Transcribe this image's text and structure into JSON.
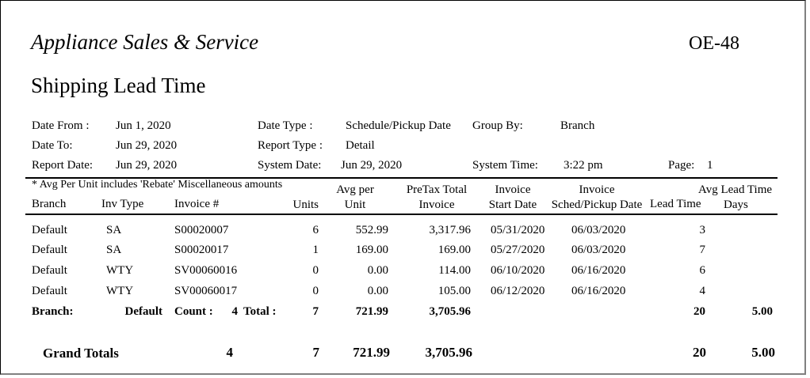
{
  "report": {
    "company": "Appliance Sales & Service",
    "code": "OE-48",
    "title": "Shipping Lead Time"
  },
  "params": {
    "date_from_label": "Date From :",
    "date_from": "Jun 1, 2020",
    "date_to_label": "Date To:",
    "date_to": "Jun 29, 2020",
    "report_date_label": "Report Date:",
    "report_date": "Jun 29, 2020",
    "date_type_label": "Date Type :",
    "date_type": "Schedule/Pickup Date",
    "report_type_label": "Report Type :",
    "report_type": "Detail",
    "system_date_label": "System Date:",
    "system_date": "Jun 29, 2020",
    "group_by_label": "Group  By:",
    "group_by": "Branch",
    "system_time_label": "System Time:",
    "system_time": "3:22 pm",
    "page_label": "Page:",
    "page": "1"
  },
  "columns": {
    "note": "* Avg Per Unit includes 'Rebate' Miscellaneous amounts",
    "branch": "Branch",
    "inv_type": "Inv Type",
    "invoice_no": "Invoice #",
    "units": "Units",
    "avg_per_1": "Avg per",
    "avg_per_2": "Unit",
    "pretax_1": "PreTax Total",
    "pretax_2": "Invoice",
    "start_1": "Invoice",
    "start_2": "Start Date",
    "sched_1": "Invoice",
    "sched_2": "Sched/Pickup Date",
    "lead_time": "Lead Time",
    "avg_lead_1": "Avg Lead Time",
    "avg_lead_2": "Days"
  },
  "rows": [
    {
      "branch": "Default",
      "inv_type": "SA",
      "invoice": "S00020007",
      "units": "6",
      "avg": "552.99",
      "pretax": "3,317.96",
      "start": "05/31/2020",
      "sched": "06/03/2020",
      "lead": "3"
    },
    {
      "branch": "Default",
      "inv_type": "SA",
      "invoice": "S00020017",
      "units": "1",
      "avg": "169.00",
      "pretax": "169.00",
      "start": "05/27/2020",
      "sched": "06/03/2020",
      "lead": "7"
    },
    {
      "branch": "Default",
      "inv_type": "WTY",
      "invoice": "SV00060016",
      "units": "0",
      "avg": "0.00",
      "pretax": "114.00",
      "start": "06/10/2020",
      "sched": "06/16/2020",
      "lead": "6"
    },
    {
      "branch": "Default",
      "inv_type": "WTY",
      "invoice": "SV00060017",
      "units": "0",
      "avg": "0.00",
      "pretax": "105.00",
      "start": "06/12/2020",
      "sched": "06/16/2020",
      "lead": "4"
    }
  ],
  "branch_total": {
    "label": "Branch:",
    "name": "Default",
    "count_label": "Count :",
    "count": "4",
    "total_label": "Total :",
    "units": "7",
    "avg": "721.99",
    "pretax": "3,705.96",
    "lead": "20",
    "avg_lead": "5.00"
  },
  "grand_total": {
    "label": "Grand Totals",
    "count": "4",
    "units": "7",
    "avg": "721.99",
    "pretax": "3,705.96",
    "lead": "20",
    "avg_lead": "5.00"
  }
}
